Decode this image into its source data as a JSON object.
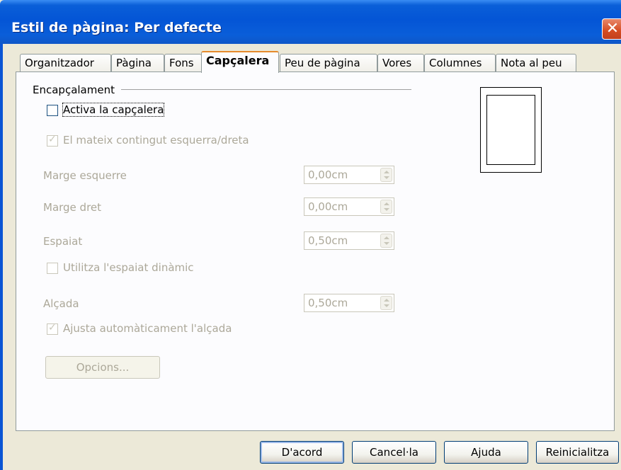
{
  "window": {
    "title": "Estil de pàgina: Per defecte",
    "close_symbol": "✕"
  },
  "tabs": [
    {
      "label": "Organitzador",
      "active": false
    },
    {
      "label": "Pàgina",
      "active": false
    },
    {
      "label": "Fons",
      "active": false
    },
    {
      "label": "Capçalera",
      "active": true
    },
    {
      "label": "Peu de pàgina",
      "active": false
    },
    {
      "label": "Vores",
      "active": false
    },
    {
      "label": "Columnes",
      "active": false
    },
    {
      "label": "Nota al peu",
      "active": false
    }
  ],
  "header_group": {
    "label": "Encapçalament",
    "activate": {
      "label": "Activa la capçalera",
      "checked": false
    },
    "same_content": {
      "label": "El mateix contingut esquerra/dreta",
      "checked": true
    },
    "left_margin": {
      "label": "Marge esquerre",
      "value": "0,00cm"
    },
    "right_margin": {
      "label": "Marge dret",
      "value": "0,00cm"
    },
    "spacing": {
      "label": "Espaiat",
      "value": "0,50cm"
    },
    "dynamic_spacing": {
      "label": "Utilitza l'espaiat dinàmic",
      "checked": false
    },
    "height": {
      "label": "Alçada",
      "value": "0,50cm"
    },
    "autofit_height": {
      "label": "Ajusta automàticament l'alçada",
      "checked": true
    },
    "options_button": "Opcions..."
  },
  "footer_buttons": {
    "ok": "D'acord",
    "cancel": "Cancel·la",
    "help": "Ajuda",
    "reset": "Reinicialitza"
  },
  "colors": {
    "titlebar": "#0455d6",
    "active_tab_accent": "#e68b2c",
    "disabled_text": "#aca899",
    "dialog_bg": "#ece9d8"
  },
  "icons": {
    "close": "close-icon",
    "spin_up": "chevron-up-icon",
    "spin_down": "chevron-down-icon",
    "check": "checkmark-icon"
  }
}
